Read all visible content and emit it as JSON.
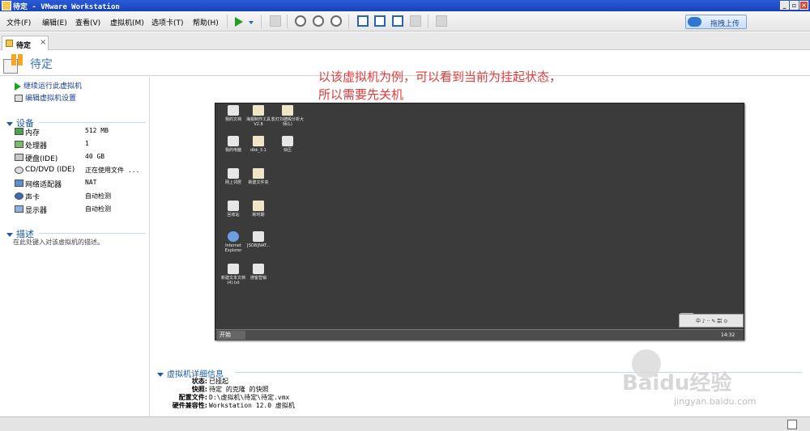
{
  "window": {
    "title": "待定 - VMware Workstation"
  },
  "menu": {
    "items": [
      "文件(F)",
      "编辑(E)",
      "查看(V)",
      "虚拟机(M)",
      "选项卡(T)",
      "帮助(H)"
    ]
  },
  "toolbar": {
    "upload_label": "拖拽上传"
  },
  "tab": {
    "label": "待定",
    "close": "×"
  },
  "vm": {
    "title": "待定",
    "actions": [
      "继续运行此虚拟机",
      "编辑虚拟机设置"
    ],
    "devices_title": "设备",
    "devices": [
      {
        "name": "内存",
        "value": "512 MB",
        "icon": "memory-icon"
      },
      {
        "name": "处理器",
        "value": "1",
        "icon": "cpu-icon"
      },
      {
        "name": "硬盘(IDE)",
        "value": "40 GB",
        "icon": "hdd-icon"
      },
      {
        "name": "CD/DVD (IDE)",
        "value": "正在使用文件 ...",
        "icon": "cd-icon"
      },
      {
        "name": "网络适配器",
        "value": "NAT",
        "icon": "network-icon"
      },
      {
        "name": "声卡",
        "value": "自动检测",
        "icon": "sound-icon"
      },
      {
        "name": "显示器",
        "value": "自动检测",
        "icon": "display-icon"
      }
    ],
    "description_title": "描述",
    "description_placeholder": "在此处键入对该虚拟机的描述。"
  },
  "annotation": {
    "line1": "以该虚拟机为例，可以看到当前为挂起状态，",
    "line2": "所以需要先关机"
  },
  "guest": {
    "desktop_icons": [
      {
        "label": "我的文档"
      },
      {
        "label": "海报制作工具V2.8"
      },
      {
        "label": "影灯刘德殿分析大师(L)"
      },
      {
        "label": "我的电脑"
      },
      {
        "label": "dbk_3.1"
      },
      {
        "label": "快压"
      },
      {
        "label": "网上邻居"
      },
      {
        "label": "新建文件夹"
      },
      {
        "label": "回收站"
      },
      {
        "label": "新时期"
      },
      {
        "label": "Internet Explorer"
      },
      {
        "label": "[SOB]NAT..."
      },
      {
        "label": "新建文本文档 (4).txt"
      },
      {
        "label": "搜客营销"
      }
    ],
    "start_label": "开始",
    "clock": "14:32",
    "ime_text": "中 ♪ ·· ✎ 㗊 ⊙"
  },
  "details": {
    "title": "虚拟机详细信息",
    "rows": [
      {
        "key": "状态:",
        "value": "已挂起"
      },
      {
        "key": "快照:",
        "value": "待定 的克隆 的快照"
      },
      {
        "key": "配置文件:",
        "value": "D:\\虚拟机\\待定\\待定.vmx"
      },
      {
        "key": "硬件兼容性:",
        "value": "Workstation 12.0 虚拟机"
      }
    ]
  },
  "watermark": {
    "brand": "Baidu经验",
    "url": "jingyan.baidu.com"
  }
}
